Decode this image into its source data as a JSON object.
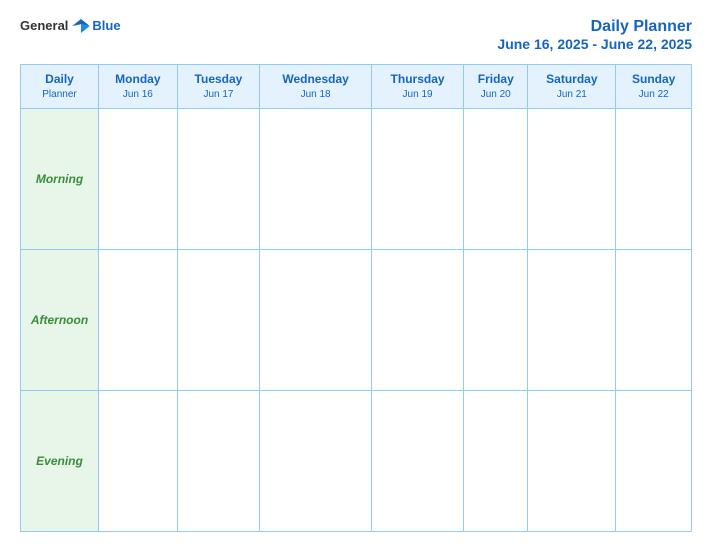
{
  "header": {
    "logo": {
      "general": "General",
      "blue": "Blue"
    },
    "title": "Daily Planner",
    "date_range": "June 16, 2025 - June 22, 2025"
  },
  "table": {
    "header_label": {
      "line1": "Daily",
      "line2": "Planner"
    },
    "columns": [
      {
        "day": "Monday",
        "date": "Jun 16"
      },
      {
        "day": "Tuesday",
        "date": "Jun 17"
      },
      {
        "day": "Wednesday",
        "date": "Jun 18"
      },
      {
        "day": "Thursday",
        "date": "Jun 19"
      },
      {
        "day": "Friday",
        "date": "Jun 20"
      },
      {
        "day": "Saturday",
        "date": "Jun 21"
      },
      {
        "day": "Sunday",
        "date": "Jun 22"
      }
    ],
    "rows": [
      {
        "label": "Morning"
      },
      {
        "label": "Afternoon"
      },
      {
        "label": "Evening"
      }
    ]
  }
}
